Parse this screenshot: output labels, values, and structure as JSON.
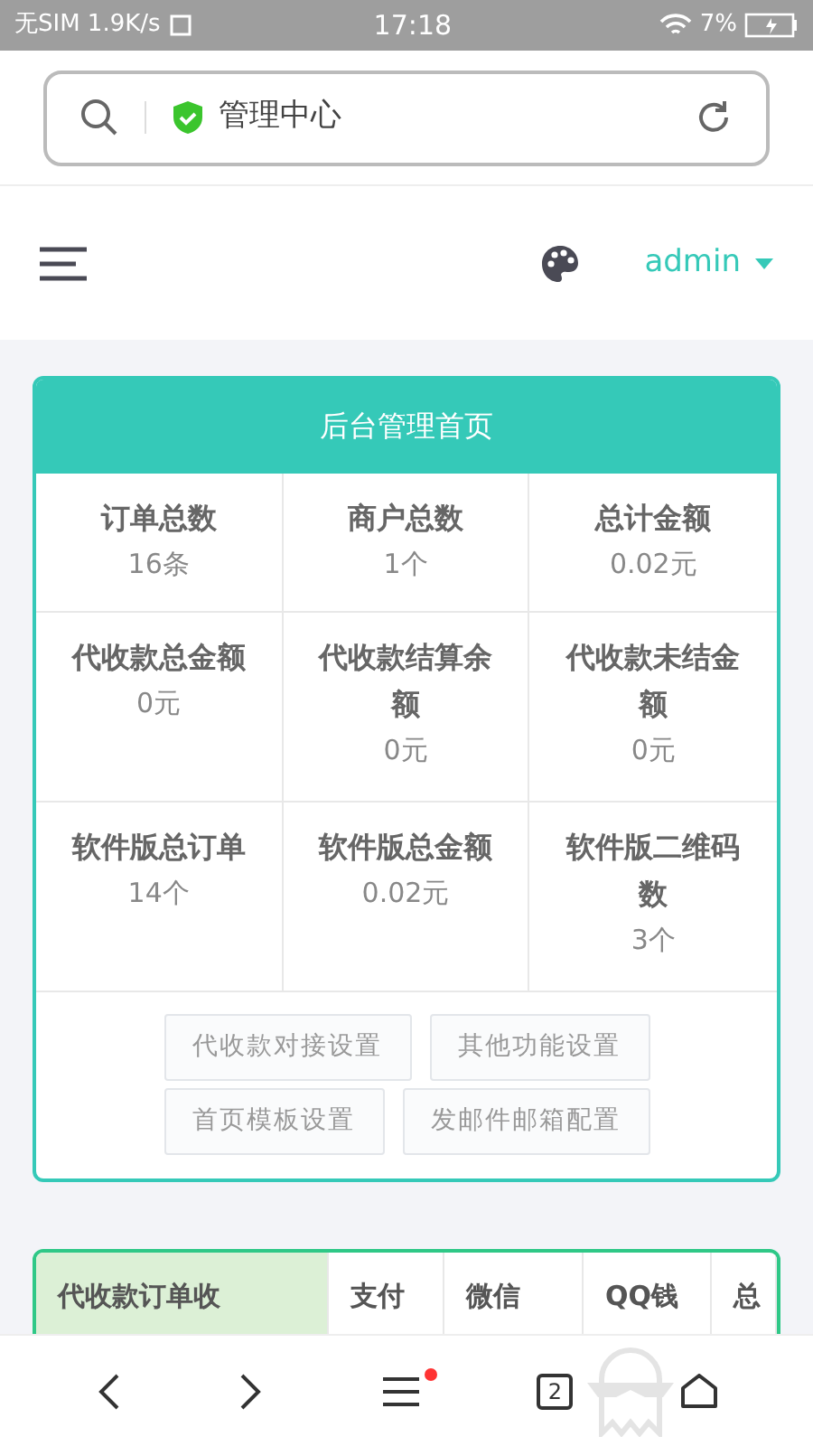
{
  "status_bar": {
    "carrier": "无SIM 1.9K/s",
    "time": "17:18",
    "battery": "7%"
  },
  "address_bar": {
    "title": "管理中心"
  },
  "header": {
    "user": "admin"
  },
  "dashboard": {
    "title": "后台管理首页",
    "stats": [
      {
        "label": "订单总数",
        "value": "16条"
      },
      {
        "label": "商户总数",
        "value": "1个"
      },
      {
        "label": "总计金额",
        "value": "0.02元"
      },
      {
        "label": "代收款总金额",
        "value": "0元"
      },
      {
        "label": "代收款结算余额",
        "value": "0元"
      },
      {
        "label": "代收款未结金额",
        "value": "0元"
      },
      {
        "label": "软件版总订单",
        "value": "14个"
      },
      {
        "label": "软件版总金额",
        "value": "0.02元"
      },
      {
        "label": "软件版二维码数",
        "value": "3个"
      }
    ],
    "buttons": [
      [
        "代收款对接设置",
        "其他功能设置"
      ],
      [
        "首页模板设置",
        "发邮件邮箱配置"
      ]
    ]
  },
  "income_table": {
    "columns": [
      "代收款订单收",
      "支付",
      "微信",
      "QQ钱",
      "总"
    ]
  },
  "bottom_nav": {
    "tabs_count": "2",
    "menu_badge": true
  }
}
